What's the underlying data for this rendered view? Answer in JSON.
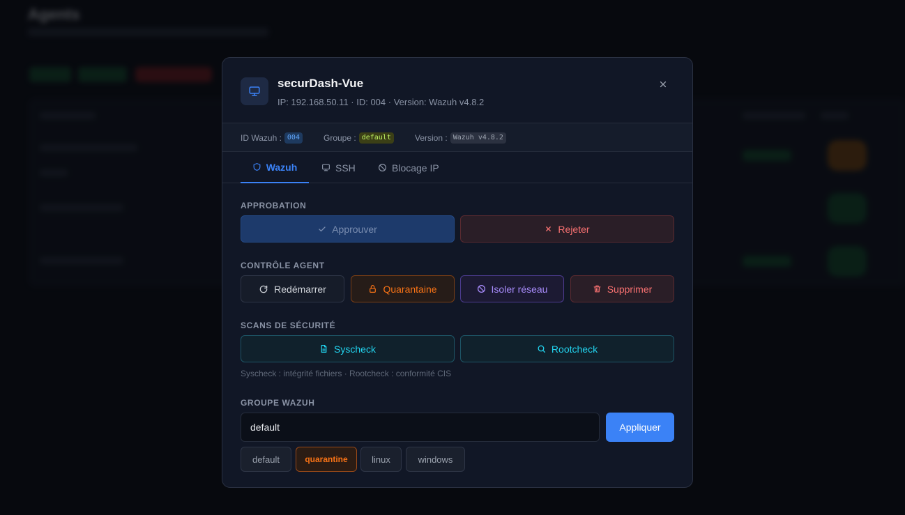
{
  "background": {
    "title": "Agents"
  },
  "modal": {
    "title": "securDash-Vue",
    "meta": "IP: 192.168.50.11 · ID: 004 · Version: Wazuh v4.8.2",
    "icon": "monitor-icon",
    "info": {
      "id_label": "ID Wazuh :",
      "id_value": "004",
      "group_label": "Groupe :",
      "group_value": "default",
      "version_label": "Version :",
      "version_value": "Wazuh v4.8.2"
    },
    "tabs": [
      {
        "label": "Wazuh",
        "icon": "shield-icon",
        "active": true
      },
      {
        "label": "SSH",
        "icon": "monitor-icon",
        "active": false
      },
      {
        "label": "Blocage IP",
        "icon": "ban-icon",
        "active": false
      }
    ],
    "approval": {
      "label": "APPROBATION",
      "approve": "Approuver",
      "reject": "Rejeter"
    },
    "control": {
      "label": "CONTRÔLE AGENT",
      "restart": "Redémarrer",
      "quarantine": "Quarantaine",
      "isolate": "Isoler réseau",
      "delete": "Supprimer"
    },
    "scans": {
      "label": "SCANS DE SÉCURITÉ",
      "syscheck": "Syscheck",
      "rootcheck": "Rootcheck",
      "note": "Syscheck : intégrité fichiers · Rootcheck : conformité CIS"
    },
    "group": {
      "label": "GROUPE WAZUH",
      "input_value": "default",
      "apply": "Appliquer",
      "options": [
        "default",
        "quarantine",
        "linux",
        "windows"
      ],
      "selected": "quarantine"
    },
    "colors": {
      "accent": "#3b82f6",
      "danger": "#f87171",
      "warning": "#f97316",
      "purple": "#a78bfa",
      "cyan": "#22d3ee"
    }
  }
}
